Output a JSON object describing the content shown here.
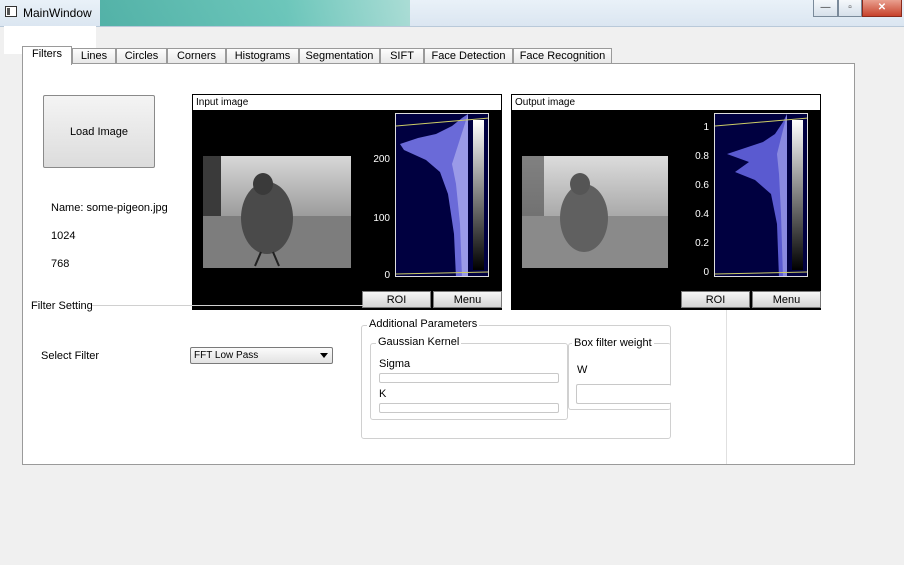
{
  "window": {
    "title": "MainWindow",
    "minimize": "—",
    "maximize": "▫",
    "close": "✕"
  },
  "tabs": [
    "Filters",
    "Lines",
    "Circles",
    "Corners",
    "Histograms",
    "Segmentation",
    "SIFT",
    "Face Detection",
    "Face Recognition"
  ],
  "load_button": "Load Image",
  "image_info": {
    "name": "Name: some-pigeon.jpg",
    "width": "1024",
    "height": "768"
  },
  "input_panel": {
    "title": "Input image",
    "ticks": [
      "200",
      "100",
      "0"
    ],
    "roi": "ROI",
    "menu": "Menu"
  },
  "output_panel": {
    "title": "Output image",
    "ticks": [
      "1",
      "0.8",
      "0.6",
      "0.4",
      "0.2",
      "0"
    ],
    "roi": "ROI",
    "menu": "Menu"
  },
  "filter_setting": {
    "title": "Filter Setting",
    "select_label": "Select Filter",
    "selected": "FFT Low Pass"
  },
  "additional": {
    "title": "Additional Parameters",
    "gaussian": {
      "title": "Gaussian Kernel",
      "sigma": "Sigma",
      "k": "K"
    },
    "box": {
      "title": "Box filter weight",
      "w": "W"
    }
  }
}
